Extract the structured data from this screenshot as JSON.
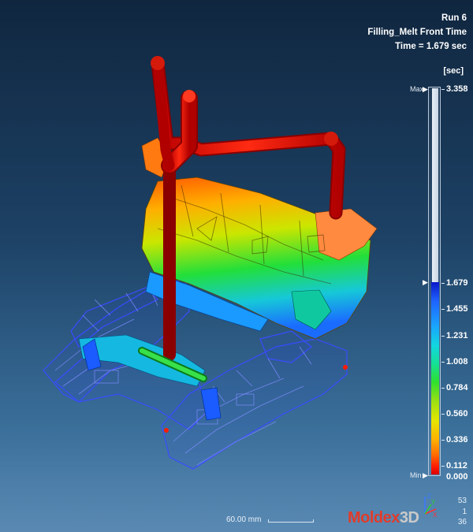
{
  "header": {
    "run": "Run 6",
    "result": "Filling_Melt Front Time",
    "time": "Time = 1.679 sec"
  },
  "legend": {
    "unit": "[sec]",
    "max_label": "Max",
    "min_label": "Min",
    "ticks": [
      "3.358",
      "1.679",
      "1.455",
      "1.231",
      "1.008",
      "0.784",
      "0.560",
      "0.336",
      "0.112",
      "0.000"
    ],
    "current_value": 1.679,
    "max_value": 3.358,
    "colors": {
      "low": "#d80000",
      "mid": "#2ee02e",
      "high": "#0a18c8"
    }
  },
  "scale": {
    "label": "60.00 mm"
  },
  "logo": {
    "part1": "Moldex",
    "part2": "3D"
  },
  "counts": [
    "53",
    "1",
    "36"
  ],
  "triad": {
    "z": "Z",
    "y": "Y",
    "x": "X"
  }
}
